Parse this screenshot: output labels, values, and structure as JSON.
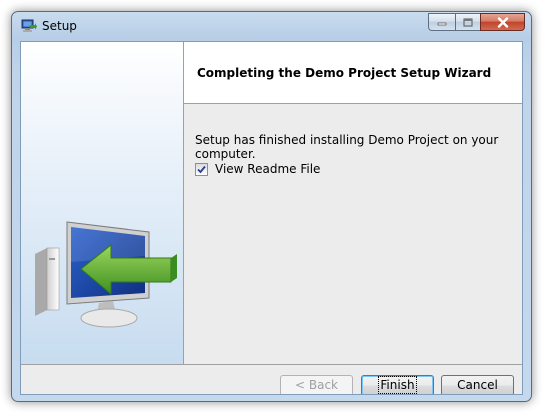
{
  "window": {
    "title": "Setup",
    "icon": "setup-icon"
  },
  "caption_buttons": {
    "minimize": "minimize-icon",
    "maximize": "maximize-icon",
    "close": "close-icon"
  },
  "wizard": {
    "header_title": "Completing the Demo Project Setup Wizard",
    "message": "Setup has finished installing Demo Project on your computer.",
    "checkbox": {
      "label": "View Readme File",
      "checked": true
    }
  },
  "buttons": {
    "back": "< Back",
    "finish": "Finish",
    "cancel": "Cancel"
  },
  "colors": {
    "close_red": "#c0432a",
    "arrow_green": "#5fae2e",
    "screen_blue": "#1e4fb4"
  }
}
